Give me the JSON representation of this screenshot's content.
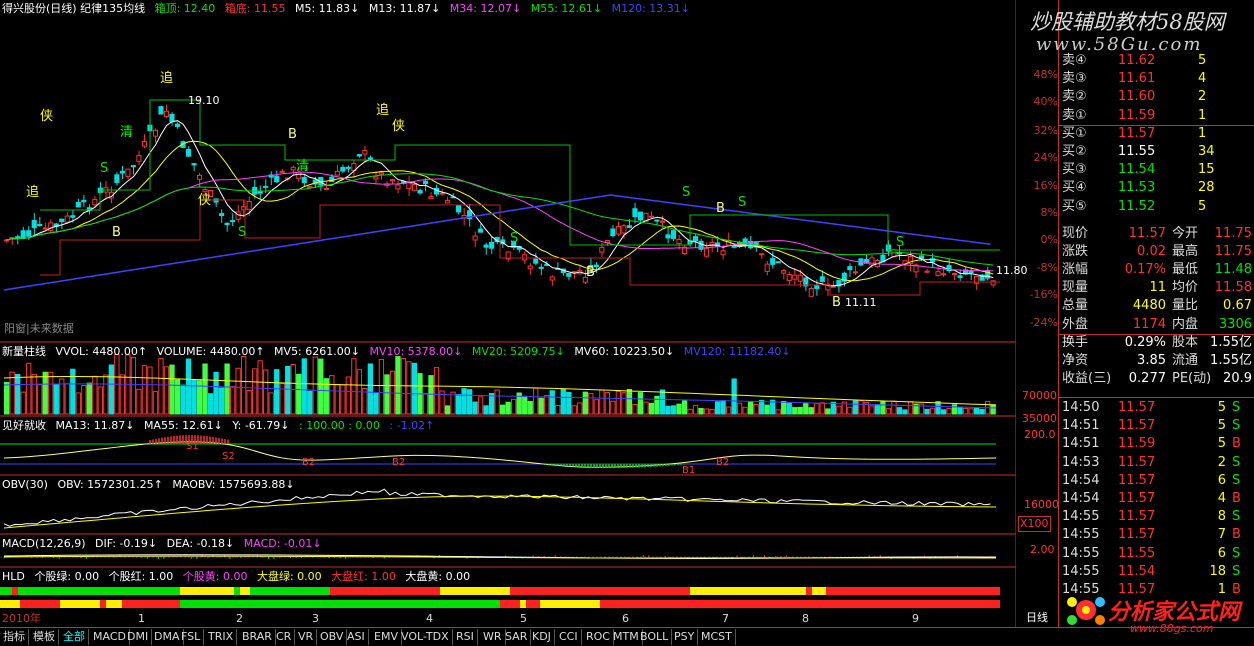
{
  "main_header": {
    "title": "得兴股份(日线) 纪律135均线",
    "box_top_label": "箱顶: 12.40",
    "box_bottom_label": "箱底: 11.55",
    "m5": "M5: 11.83↓",
    "m13": "M13: 11.87↓",
    "m34": "M34: 12.07↓",
    "m55": "M55: 12.61↓",
    "m120": "M120: 13.31↓"
  },
  "main_chart": {
    "high_mark": "19.10",
    "low_mark": "11.11",
    "right_mark": "11.80",
    "corner_note": "阳窗|未来数据",
    "sig_letters": [
      "追",
      "侠",
      "S",
      "B",
      "清",
      "追",
      "侠",
      "S",
      "B",
      "清",
      "追",
      "侠",
      "S",
      "B",
      "S",
      "B",
      "S",
      "B",
      "S"
    ]
  },
  "pct_axis": [
    "48%",
    "40%",
    "32%",
    "24%",
    "16%",
    "8%",
    "0%",
    "-8%",
    "-16%",
    "-24%"
  ],
  "volume_header": {
    "title": "新量柱线",
    "vvol": "VVOL: 4480.00↑",
    "volume": "VOLUME: 4480.00↑",
    "mv5": "MV5: 6261.00↓",
    "mv10": "MV10: 5378.00↓",
    "mv20": "MV20: 5209.75↓",
    "mv60": "MV60: 10223.50↓",
    "mv120": "MV120: 11182.40↓"
  },
  "volume_axis": [
    "70000",
    "35000"
  ],
  "ind1_header": {
    "title": "见好就收",
    "ma13": "MA13: 11.87↓",
    "ma55": "MA55: 12.61↓",
    "y": "Y: -61.79↓",
    "a": ": 100.00 : 0.00",
    "b": ": -1.02↑"
  },
  "ind1_axis": [
    "200.0"
  ],
  "ind1_marks": [
    "S1",
    "S2",
    "B2",
    "B2",
    "B1",
    "B2"
  ],
  "obv_header": {
    "title": "OBV(30)",
    "obv": "OBV: 1572301.25↑",
    "maobv": "MAOBV: 1575693.88↓"
  },
  "obv_axis": [
    "16000",
    "X100"
  ],
  "macd_header": {
    "title": "MACD(12,26,9)",
    "dif": "DIF: -0.19↓",
    "dea": "DEA: -0.18↓",
    "macd": "MACD: -0.01↓"
  },
  "macd_axis": [
    "2.00"
  ],
  "hld_header": {
    "title": "HLD",
    "g1": "个股绿: 0.00",
    "g2": "个股红: 1.00",
    "g3": "个股黄: 0.00",
    "m1": "大盘绿: 0.00",
    "m2": "大盘红: 1.00",
    "m3": "大盘黄: 0.00"
  },
  "x_axis": {
    "year": "2010年",
    "months": [
      "1",
      "2",
      "3",
      "4",
      "5",
      "6",
      "7",
      "8",
      "9"
    ]
  },
  "period_label": "日线",
  "watermark": {
    "line1": "炒股辅助教材58股网",
    "line2": "www.58Gu.com"
  },
  "order_book": {
    "sells": [
      {
        "label": "卖④",
        "price": "11.62",
        "vol": "5"
      },
      {
        "label": "卖③",
        "price": "11.61",
        "vol": "4"
      },
      {
        "label": "卖②",
        "price": "11.60",
        "vol": "2"
      },
      {
        "label": "卖①",
        "price": "11.59",
        "vol": "1"
      }
    ],
    "buys": [
      {
        "label": "买①",
        "price": "11.57",
        "vol": "1"
      },
      {
        "label": "买②",
        "price": "11.55",
        "vol": "34"
      },
      {
        "label": "买③",
        "price": "11.54",
        "vol": "15"
      },
      {
        "label": "买④",
        "price": "11.53",
        "vol": "28"
      },
      {
        "label": "买⑤",
        "price": "11.52",
        "vol": "5"
      }
    ]
  },
  "stats": [
    {
      "l1": "现价",
      "v1": "11.57",
      "l2": "今开",
      "v2": "11.75"
    },
    {
      "l1": "涨跌",
      "v1": "0.02",
      "l2": "最高",
      "v2": "11.75"
    },
    {
      "l1": "涨幅",
      "v1": "0.17%",
      "l2": "最低",
      "v2": "11.48"
    },
    {
      "l1": "现量",
      "v1": "11",
      "l2": "均价",
      "v2": "11.58"
    },
    {
      "l1": "总量",
      "v1": "4480",
      "l2": "量比",
      "v2": "0.67"
    },
    {
      "l1": "外盘",
      "v1": "1174",
      "l2": "内盘",
      "v2": "3306"
    },
    {
      "l1": "换手",
      "v1": "0.29%",
      "l2": "股本",
      "v2": "1.55亿"
    },
    {
      "l1": "净资",
      "v1": "3.85",
      "l2": "流通",
      "v2": "1.55亿"
    },
    {
      "l1": "收益(三)",
      "v1": "0.277",
      "l2": "PE(动)",
      "v2": "20.9"
    }
  ],
  "ticks": [
    {
      "t": "14:50",
      "p": "11.57",
      "v": "5",
      "f": "S",
      "fc": "green"
    },
    {
      "t": "14:51",
      "p": "11.57",
      "v": "5",
      "f": "S",
      "fc": "green"
    },
    {
      "t": "14:51",
      "p": "11.59",
      "v": "5",
      "f": "B",
      "fc": "red"
    },
    {
      "t": "14:53",
      "p": "11.57",
      "v": "2",
      "f": "S",
      "fc": "green"
    },
    {
      "t": "14:54",
      "p": "11.57",
      "v": "6",
      "f": "S",
      "fc": "green"
    },
    {
      "t": "14:54",
      "p": "11.57",
      "v": "4",
      "f": "B",
      "fc": "red"
    },
    {
      "t": "14:55",
      "p": "11.57",
      "v": "8",
      "f": "S",
      "fc": "green"
    },
    {
      "t": "14:55",
      "p": "11.57",
      "v": "7",
      "f": "B",
      "fc": "red"
    },
    {
      "t": "14:55",
      "p": "11.55",
      "v": "6",
      "f": "S",
      "fc": "green"
    },
    {
      "t": "14:55",
      "p": "11.54",
      "v": "18",
      "f": "S",
      "fc": "green"
    },
    {
      "t": "14:55",
      "p": "11.57",
      "v": "1",
      "f": "B",
      "fc": "red"
    }
  ],
  "tabs": [
    "指标",
    "模板",
    "全部",
    "MACD",
    "DMI",
    "DMA",
    "FSL",
    "TRIX",
    "BRAR",
    "CR",
    "VR",
    "OBV",
    "ASI",
    "EMV",
    "VOL-TDX",
    "RSI",
    "WR",
    "SAR",
    "KDJ",
    "CCI",
    "ROC",
    "MTM",
    "BOLL",
    "PSY",
    "MCST"
  ],
  "logo": {
    "text": "分析家公式网",
    "url": "www.88gs.com"
  },
  "colors": {
    "up": "#ff3030",
    "down": "#00e0e0",
    "ma5": "#ffffff",
    "ma13": "#ffff00",
    "ma34": "#ff40ff",
    "ma55": "#00e000",
    "ma120": "#4040ff"
  }
}
